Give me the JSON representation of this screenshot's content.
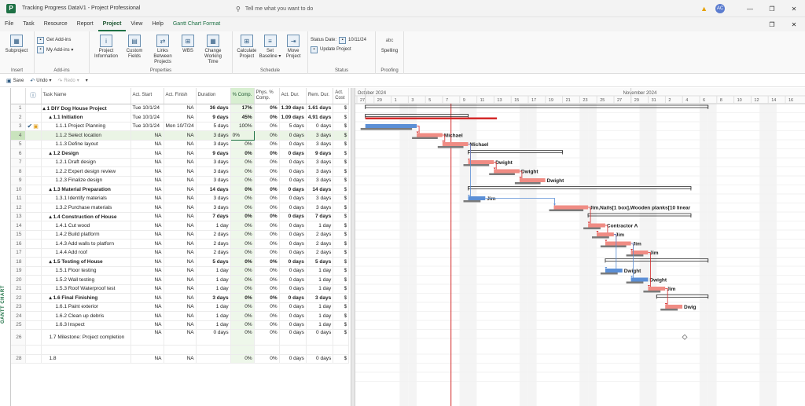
{
  "window": {
    "title": "Tracking Progress DataV1  -  Project Professional",
    "search_placeholder": "Tell me what you want to do",
    "user_initials": "AC",
    "app_icon": "P"
  },
  "menu": {
    "tabs": [
      "File",
      "Task",
      "Resource",
      "Report",
      "Project",
      "View",
      "Help",
      "Gantt Chart Format"
    ],
    "active": "Project"
  },
  "ribbon": {
    "groups": [
      {
        "label": "Insert",
        "buttons": [
          {
            "label": "Subproject",
            "icon": "subproject-icon"
          }
        ]
      },
      {
        "label": "Add-ins",
        "small": [
          {
            "label": "Get Add-ins"
          },
          {
            "label": "My Add-ins ▾"
          }
        ]
      },
      {
        "label": "Properties",
        "buttons": [
          {
            "label": "Project Information"
          },
          {
            "label": "Custom Fields"
          },
          {
            "label": "Links Between Projects"
          },
          {
            "label": "WBS"
          },
          {
            "label": "Change Working Time"
          }
        ]
      },
      {
        "label": "Schedule",
        "buttons": [
          {
            "label": "Calculate Project"
          },
          {
            "label": "Set Baseline ▾"
          },
          {
            "label": "Move Project"
          }
        ]
      },
      {
        "label": "Status",
        "status_date_label": "Status Date:",
        "status_date": "10/11/24",
        "update_label": "Update Project"
      },
      {
        "label": "Proofing",
        "buttons": [
          {
            "label": "Spelling",
            "glyph": "abc"
          }
        ]
      }
    ]
  },
  "qat": {
    "save": "Save",
    "undo": "Undo",
    "redo": "Redo"
  },
  "view_label": "GANTT CHART",
  "grid": {
    "headers": [
      "",
      "",
      "Task Name",
      "Act. Start",
      "Act. Finish",
      "Duration",
      "% Comp.",
      "Phys. % Comp.",
      "Act. Dur.",
      "Rem. Dur.",
      "Act. Cost"
    ],
    "rows": [
      {
        "id": "1",
        "name": "▴ 1 DIY Dog House Project",
        "indent": 0,
        "summary": true,
        "start": "Tue 10/1/24",
        "finish": "NA",
        "dur": "36 days",
        "pct": "17%",
        "phys": "0%",
        "adur": "1.39 days",
        "rdur": "1.61 days",
        "cost": "$"
      },
      {
        "id": "2",
        "name": "▴ 1.1 Initiation",
        "indent": 1,
        "summary": true,
        "start": "Tue 10/1/24",
        "finish": "NA",
        "dur": "9 days",
        "pct": "45%",
        "phys": "0%",
        "adur": "1.09 days",
        "rdur": "4.91 days",
        "cost": "$"
      },
      {
        "id": "3",
        "name": "1.1.1 Project Planning",
        "indent": 2,
        "start": "Tue 10/1/24",
        "finish": "Mon 10/7/24",
        "dur": "5 days",
        "pct": "100%",
        "phys": "0%",
        "adur": "5 days",
        "rdur": "0 days",
        "cost": "$",
        "check": true
      },
      {
        "id": "4",
        "name": "1.1.2 Select location",
        "indent": 2,
        "start": "NA",
        "finish": "NA",
        "dur": "3 days",
        "pct": "0%",
        "phys": "0%",
        "adur": "0 days",
        "rdur": "3 days",
        "cost": "$",
        "selected": true
      },
      {
        "id": "5",
        "name": "1.1.3 Define layout",
        "indent": 2,
        "start": "NA",
        "finish": "NA",
        "dur": "3 days",
        "pct": "0%",
        "phys": "0%",
        "adur": "0 days",
        "rdur": "3 days",
        "cost": "$"
      },
      {
        "id": "6",
        "name": "▴ 1.2 Design",
        "indent": 1,
        "summary": true,
        "start": "NA",
        "finish": "NA",
        "dur": "9 days",
        "pct": "0%",
        "phys": "0%",
        "adur": "0 days",
        "rdur": "9 days",
        "cost": "$"
      },
      {
        "id": "7",
        "name": "1.2.1 Draft design",
        "indent": 2,
        "start": "NA",
        "finish": "NA",
        "dur": "3 days",
        "pct": "0%",
        "phys": "0%",
        "adur": "0 days",
        "rdur": "3 days",
        "cost": "$"
      },
      {
        "id": "8",
        "name": "1.2.2 Expert design review",
        "indent": 2,
        "start": "NA",
        "finish": "NA",
        "dur": "3 days",
        "pct": "0%",
        "phys": "0%",
        "adur": "0 days",
        "rdur": "3 days",
        "cost": "$"
      },
      {
        "id": "9",
        "name": "1.2.3 Finalize design",
        "indent": 2,
        "start": "NA",
        "finish": "NA",
        "dur": "3 days",
        "pct": "0%",
        "phys": "0%",
        "adur": "0 days",
        "rdur": "3 days",
        "cost": "$"
      },
      {
        "id": "10",
        "name": "▴ 1.3 Material Preparation",
        "indent": 1,
        "summary": true,
        "start": "NA",
        "finish": "NA",
        "dur": "14 days",
        "pct": "0%",
        "phys": "0%",
        "adur": "0 days",
        "rdur": "14 days",
        "cost": "$"
      },
      {
        "id": "11",
        "name": "1.3.1 Identify materials",
        "indent": 2,
        "start": "NA",
        "finish": "NA",
        "dur": "3 days",
        "pct": "0%",
        "phys": "0%",
        "adur": "0 days",
        "rdur": "3 days",
        "cost": "$"
      },
      {
        "id": "12",
        "name": "1.3.2 Purchase materials",
        "indent": 2,
        "start": "NA",
        "finish": "NA",
        "dur": "3 days",
        "pct": "0%",
        "phys": "0%",
        "adur": "0 days",
        "rdur": "3 days",
        "cost": "$"
      },
      {
        "id": "13",
        "name": "▴ 1.4 Construction of House",
        "indent": 1,
        "summary": true,
        "start": "NA",
        "finish": "NA",
        "dur": "7 days",
        "pct": "0%",
        "phys": "0%",
        "adur": "0 days",
        "rdur": "7 days",
        "cost": "$"
      },
      {
        "id": "14",
        "name": "1.4.1 Cut wood",
        "indent": 2,
        "start": "NA",
        "finish": "NA",
        "dur": "1 day",
        "pct": "0%",
        "phys": "0%",
        "adur": "0 days",
        "rdur": "1 day",
        "cost": "$"
      },
      {
        "id": "15",
        "name": "1.4.2 Build platform",
        "indent": 2,
        "start": "NA",
        "finish": "NA",
        "dur": "2 days",
        "pct": "0%",
        "phys": "0%",
        "adur": "0 days",
        "rdur": "2 days",
        "cost": "$"
      },
      {
        "id": "16",
        "name": "1.4.3 Add walls to platforn",
        "indent": 2,
        "start": "NA",
        "finish": "NA",
        "dur": "2 days",
        "pct": "0%",
        "phys": "0%",
        "adur": "0 days",
        "rdur": "2 days",
        "cost": "$"
      },
      {
        "id": "17",
        "name": "1.4.4 Add roof",
        "indent": 2,
        "start": "NA",
        "finish": "NA",
        "dur": "2 days",
        "pct": "0%",
        "phys": "0%",
        "adur": "0 days",
        "rdur": "2 days",
        "cost": "$"
      },
      {
        "id": "18",
        "name": "▴ 1.5 Testing of House",
        "indent": 1,
        "summary": true,
        "start": "NA",
        "finish": "NA",
        "dur": "5 days",
        "pct": "0%",
        "phys": "0%",
        "adur": "0 days",
        "rdur": "5 days",
        "cost": "$"
      },
      {
        "id": "19",
        "name": "1.5.1 Floor testing",
        "indent": 2,
        "start": "NA",
        "finish": "NA",
        "dur": "1 day",
        "pct": "0%",
        "phys": "0%",
        "adur": "0 days",
        "rdur": "1 day",
        "cost": "$"
      },
      {
        "id": "20",
        "name": "1.5.2 Wall testing",
        "indent": 2,
        "start": "NA",
        "finish": "NA",
        "dur": "1 day",
        "pct": "0%",
        "phys": "0%",
        "adur": "0 days",
        "rdur": "1 day",
        "cost": "$"
      },
      {
        "id": "21",
        "name": "1.5.3 Roof Waterproof test",
        "indent": 2,
        "start": "NA",
        "finish": "NA",
        "dur": "1 day",
        "pct": "0%",
        "phys": "0%",
        "adur": "0 days",
        "rdur": "1 day",
        "cost": "$"
      },
      {
        "id": "22",
        "name": "▴ 1.6 Final Finishing",
        "indent": 1,
        "summary": true,
        "start": "NA",
        "finish": "NA",
        "dur": "3 days",
        "pct": "0%",
        "phys": "0%",
        "adur": "0 days",
        "rdur": "3 days",
        "cost": "$"
      },
      {
        "id": "23",
        "name": "1.6.1 Paint exterior",
        "indent": 2,
        "start": "NA",
        "finish": "NA",
        "dur": "1 day",
        "pct": "0%",
        "phys": "0%",
        "adur": "0 days",
        "rdur": "1 day",
        "cost": "$"
      },
      {
        "id": "24",
        "name": "1.6.2 Clean up debris",
        "indent": 2,
        "start": "NA",
        "finish": "NA",
        "dur": "1 day",
        "pct": "0%",
        "phys": "0%",
        "adur": "0 days",
        "rdur": "1 day",
        "cost": "$"
      },
      {
        "id": "25",
        "name": "1.6.3 Inspect",
        "indent": 2,
        "start": "NA",
        "finish": "NA",
        "dur": "1 day",
        "pct": "0%",
        "phys": "0%",
        "adur": "0 days",
        "rdur": "1 day",
        "cost": "$"
      },
      {
        "id": "26",
        "name": "1.7 Milestone: Project completion",
        "indent": 1,
        "start": "NA",
        "finish": "NA",
        "dur": "0 days",
        "pct": "0%",
        "phys": "0%",
        "adur": "0 days",
        "rdur": "0 days",
        "cost": "$",
        "tall": true
      },
      {
        "id": "",
        "name": "",
        "indent": 0,
        "start": "",
        "finish": "",
        "dur": "",
        "pct": "",
        "phys": "",
        "adur": "",
        "rdur": "",
        "cost": ""
      },
      {
        "id": "28",
        "name": "1.8",
        "indent": 1,
        "start": "NA",
        "finish": "NA",
        "dur": "",
        "pct": "0%",
        "phys": "0%",
        "adur": "0 days",
        "rdur": "0 days",
        "cost": "$"
      }
    ]
  },
  "timescale": {
    "months": [
      {
        "label": "October 2024",
        "day_index": 1
      },
      {
        "label": "November 2024",
        "day_index": 32
      }
    ],
    "days": [
      "27",
      "29",
      "1",
      "3",
      "5",
      "7",
      "9",
      "11",
      "13",
      "15",
      "17",
      "19",
      "21",
      "23",
      "25",
      "27",
      "29",
      "31",
      "2",
      "4",
      "6",
      "8",
      "10",
      "12",
      "14",
      "16"
    ],
    "status_day_index": 11
  },
  "gantt": {
    "bars": [
      {
        "row": 0,
        "type": "summary",
        "start": 1,
        "end": 40
      },
      {
        "row": 1,
        "type": "summary",
        "start": 1,
        "end": 12,
        "progress": 0.45
      },
      {
        "row": 2,
        "type": "done",
        "start": 1,
        "end": 6
      },
      {
        "row": 3,
        "type": "task",
        "start": 7,
        "end": 9,
        "label": "Michael"
      },
      {
        "row": 4,
        "type": "task",
        "start": 10,
        "end": 12,
        "label": "Michael"
      },
      {
        "row": 5,
        "type": "summary",
        "start": 13,
        "end": 23
      },
      {
        "row": 6,
        "type": "task",
        "start": 13,
        "end": 15,
        "label": "Dwight"
      },
      {
        "row": 7,
        "type": "task",
        "start": 16,
        "end": 18,
        "label": "Dwight"
      },
      {
        "row": 8,
        "type": "task",
        "start": 19,
        "end": 21,
        "label": "Dwight"
      },
      {
        "row": 9,
        "type": "summary",
        "start": 13,
        "end": 38
      },
      {
        "row": 10,
        "type": "blue",
        "start": 13,
        "end": 14,
        "label": "Jim"
      },
      {
        "row": 11,
        "type": "task",
        "start": 23,
        "end": 26,
        "label": "Jim,Nails[1 box],Wooden planks[10 linear"
      },
      {
        "row": 12,
        "type": "summary",
        "start": 27,
        "end": 38
      },
      {
        "row": 13,
        "type": "task",
        "start": 27,
        "end": 28,
        "label": "Contractor A"
      },
      {
        "row": 14,
        "type": "task",
        "start": 28,
        "end": 29,
        "label": "Jim"
      },
      {
        "row": 15,
        "type": "task",
        "start": 29,
        "end": 31,
        "label": "Jim"
      },
      {
        "row": 16,
        "type": "task",
        "start": 32,
        "end": 33,
        "label": "Jim"
      },
      {
        "row": 17,
        "type": "summary",
        "start": 29,
        "end": 40
      },
      {
        "row": 18,
        "type": "blue",
        "start": 29,
        "end": 30,
        "label": "Dwight"
      },
      {
        "row": 19,
        "type": "blue",
        "start": 32,
        "end": 33,
        "label": "Dwight"
      },
      {
        "row": 20,
        "type": "task",
        "start": 34,
        "end": 35,
        "label": "Jim"
      },
      {
        "row": 21,
        "type": "summary",
        "start": 35,
        "end": 40
      },
      {
        "row": 22,
        "type": "task",
        "start": 36,
        "end": 37,
        "label": "Dwig"
      },
      {
        "row": 25,
        "type": "milestone",
        "start": 38,
        "end": 38
      }
    ]
  },
  "colors": {
    "accent": "#1e7145",
    "task_bar": "#f08c84",
    "critical": "#d42a2a",
    "done_bar": "#5b8fd6",
    "baseline": "#7a7a7a",
    "status_line": "#d42a2a"
  }
}
